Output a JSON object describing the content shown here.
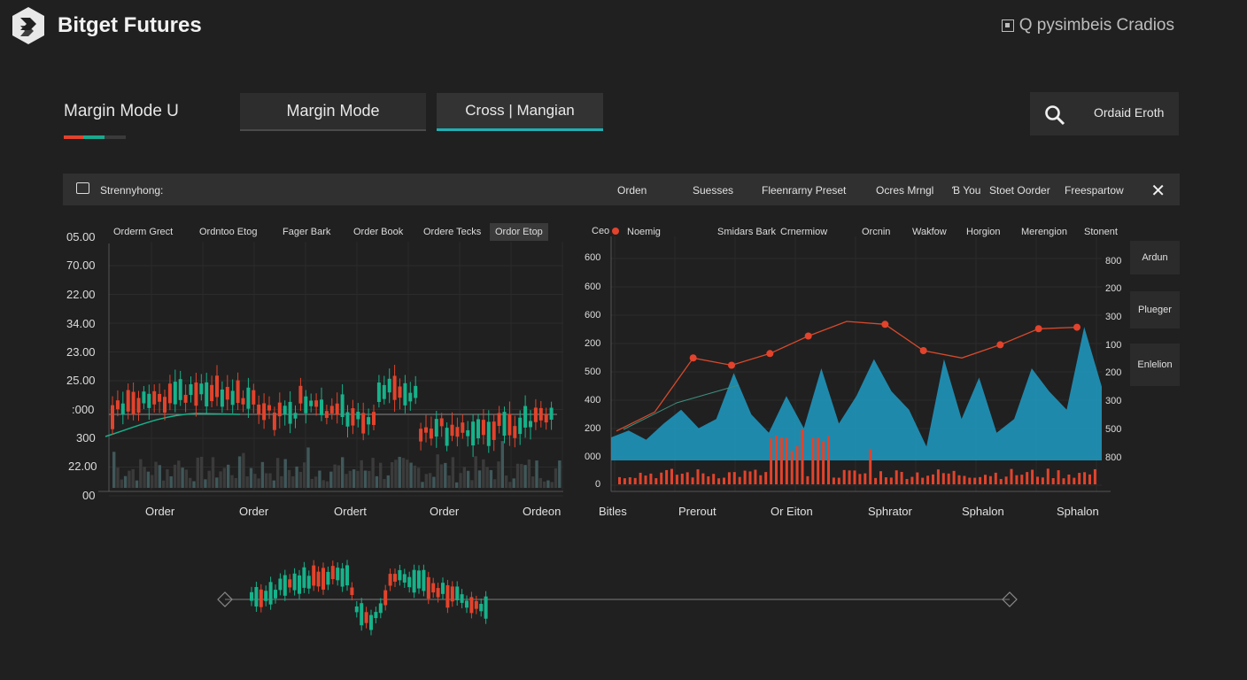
{
  "header": {
    "title": "Bitget Futures",
    "search_text": "Q pysimbeis Cradios"
  },
  "margin": {
    "label": "Margin Mode U",
    "btn_margin_mode": "Margin Mode",
    "btn_cross_margin": "Cross | Mangian"
  },
  "order_button": {
    "label": "Ordaid Eroth",
    "icon": "search-icon"
  },
  "toolbar": {
    "title": "Strennyhong:",
    "items": [
      "Orden",
      "Suesses",
      "Fleenrarny Preset",
      "Ocres Mrngl",
      "Ɓ You",
      "Stoet Oorder",
      "Freespartow"
    ],
    "close": "✕"
  },
  "left_chart": {
    "tabs": [
      "Orderm Grect",
      "Ordntoo Etog",
      "Fager Bark",
      "Order Book",
      "Ordere Tecks",
      "Ordor Etop"
    ],
    "active_tab": 5,
    "y_ticks": [
      "05.00",
      "70.00",
      "22.00",
      "34.00",
      "23.00",
      "25.00",
      ":000",
      "300",
      "22.00",
      "00"
    ],
    "x_labels": [
      "Order",
      "Order",
      "Ordert",
      "Order",
      "Ordeon"
    ]
  },
  "right_chart": {
    "legend_item": "Ceo",
    "tabs": [
      "Noemig",
      "Smidars Bark",
      "Crnermiow",
      "Orcnin",
      "Wakfow",
      "Horgion",
      "Merengion",
      "Stonent"
    ],
    "y_ticks_left": [
      "600",
      "600",
      "600",
      "200",
      "500",
      "400",
      "200",
      "000",
      "0"
    ],
    "y_ticks_right": [
      "800",
      "200",
      "300",
      "100",
      "200",
      "300",
      "500",
      "800"
    ],
    "x_labels": [
      "Bitles",
      "Prerout",
      "Or Eiton",
      "Sphrator",
      "Sphalon",
      "Sphalon"
    ]
  },
  "side_buttons": [
    "Ardun",
    "Plueger",
    "Enlelion"
  ],
  "colors": {
    "up": "#16b28a",
    "down": "#e2432c",
    "area": "#1f93b8",
    "accent": "#1fb0b3"
  },
  "chart_data": [
    {
      "type": "candlestick",
      "title": "",
      "x_labels": [
        "Order",
        "Order",
        "Ordert",
        "Order",
        "Ordeon"
      ],
      "y_ticks": [
        "05.00",
        "70.00",
        "22.00",
        "34.00",
        "23.00",
        "25.00",
        ":000",
        "300",
        "22.00",
        "00"
      ]
    },
    {
      "type": "area",
      "series": [
        {
          "values": [
            10,
            13,
            9,
            16,
            22,
            14,
            18,
            38,
            20,
            12,
            28,
            14,
            40,
            16,
            28,
            44,
            30,
            22,
            6,
            44,
            18,
            36,
            12,
            18,
            40,
            30,
            22,
            58,
            32
          ]
        },
        {
          "values": [
            5,
            18,
            55,
            50,
            58,
            70,
            80,
            78,
            60,
            55,
            64,
            75,
            76
          ]
        }
      ],
      "x_labels": [
        "Bitles",
        "Prerout",
        "Or Eiton",
        "Sphrator",
        "Sphalon",
        "Sphalon"
      ]
    }
  ]
}
